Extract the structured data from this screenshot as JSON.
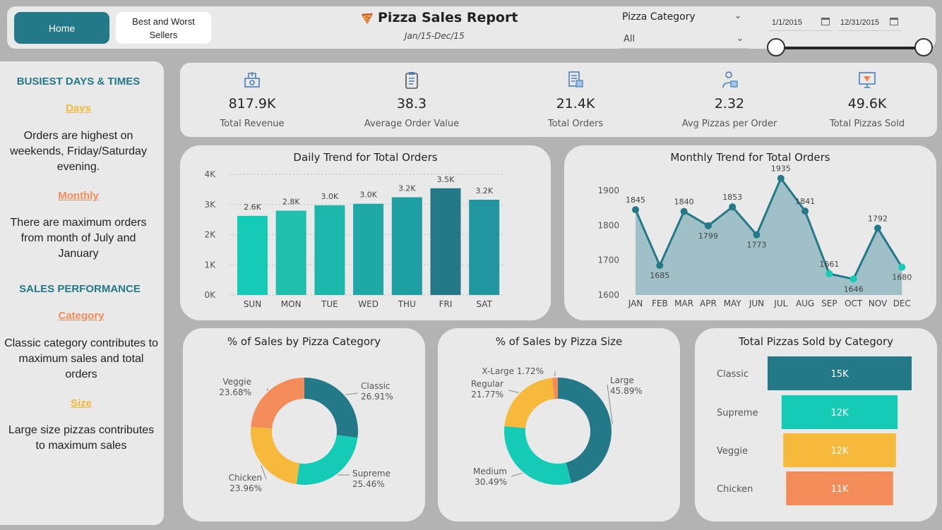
{
  "nav": {
    "home_label": "Home",
    "best_label": "Best and Worst Sellers"
  },
  "header": {
    "title": "Pizza Sales Report",
    "subtitle": "Jan/15-Dec/15",
    "icon": "pizza-icon"
  },
  "filters": {
    "category_label": "Pizza Category",
    "category_value": "All",
    "date_start": "1/1/2015",
    "date_end": "12/31/2015"
  },
  "insights": {
    "busiest_heading": "BUSIEST DAYS & TIMES",
    "days_label": "Days",
    "days_text": "Orders are highest on weekends, Friday/Saturday evening.",
    "monthly_label": "Monthly",
    "monthly_text": "There are maximum orders from month of July and January",
    "sales_heading": "SALES PERFORMANCE",
    "category_label": "Category",
    "category_text": "Classic category contributes to maximum sales and total orders",
    "size_label": "Size",
    "size_text": "Large size pizzas contributes to maximum sales"
  },
  "kpis": [
    {
      "value": "817.9K",
      "label": "Total Revenue",
      "icon": "money-icon"
    },
    {
      "value": "38.3",
      "label": "Average Order Value",
      "icon": "clipboard-icon"
    },
    {
      "value": "21.4K",
      "label": "Total Orders",
      "icon": "order-list-icon"
    },
    {
      "value": "2.32",
      "label": "Avg Pizzas per Order",
      "icon": "delivery-person-icon"
    },
    {
      "value": "49.6K",
      "label": "Total Pizzas Sold",
      "icon": "monitor-pizza-icon"
    }
  ],
  "colors": {
    "primary": "#247989",
    "accent_orange": "#f48c5a",
    "accent_yellow": "#f6b93b",
    "teal": "#14cbb6",
    "background": "#b3b3b3",
    "card": "#e9e9e9"
  },
  "chart_data": [
    {
      "id": "daily",
      "type": "bar",
      "title": "Daily Trend for Total Orders",
      "categories": [
        "SUN",
        "MON",
        "TUE",
        "WED",
        "THU",
        "FRI",
        "SAT"
      ],
      "values": [
        2624,
        2794,
        2973,
        3024,
        3239,
        3538,
        3158
      ],
      "data_labels": [
        "2.6K",
        "2.8K",
        "3.0K",
        "3.0K",
        "3.2K",
        "3.5K",
        "3.2K"
      ],
      "yticks": [
        "0K",
        "1K",
        "2K",
        "3K",
        "4K"
      ],
      "ylim": [
        0,
        4000
      ],
      "grid": true
    },
    {
      "id": "monthly",
      "type": "area",
      "title": "Monthly Trend for Total Orders",
      "categories": [
        "JAN",
        "FEB",
        "MAR",
        "APR",
        "MAY",
        "JUN",
        "JUL",
        "AUG",
        "SEP",
        "OCT",
        "NOV",
        "DEC"
      ],
      "values": [
        1845,
        1685,
        1840,
        1799,
        1853,
        1773,
        1935,
        1841,
        1661,
        1646,
        1792,
        1680
      ],
      "yticks": [
        "1600",
        "1700",
        "1800",
        "1900"
      ],
      "ylim": [
        1600,
        1900
      ],
      "grid": false
    },
    {
      "id": "category",
      "type": "pie",
      "title": "% of Sales by Pizza Category",
      "slices": [
        {
          "name": "Classic",
          "value": 26.91,
          "label": "26.91%",
          "color": "#247989"
        },
        {
          "name": "Supreme",
          "value": 25.46,
          "label": "25.46%",
          "color": "#14cbb6"
        },
        {
          "name": "Chicken",
          "value": 23.96,
          "label": "23.96%",
          "color": "#f6b93b"
        },
        {
          "name": "Veggie",
          "value": 23.68,
          "label": "23.68%",
          "color": "#f48c5a"
        }
      ]
    },
    {
      "id": "size",
      "type": "pie",
      "title": "% of Sales by Pizza Size",
      "slices": [
        {
          "name": "Large",
          "value": 45.89,
          "label": "45.89%",
          "color": "#247989"
        },
        {
          "name": "Medium",
          "value": 30.49,
          "label": "30.49%",
          "color": "#14cbb6"
        },
        {
          "name": "Regular",
          "value": 21.77,
          "label": "21.77%",
          "color": "#f6b93b"
        },
        {
          "name": "X-Large",
          "value": 1.72,
          "label": "1.72%",
          "color": "#f48c5a"
        }
      ]
    },
    {
      "id": "funnel",
      "type": "bar",
      "title": "Total Pizzas Sold by Category",
      "categories": [
        "Classic",
        "Supreme",
        "Veggie",
        "Chicken"
      ],
      "values": [
        14888,
        11987,
        11649,
        11050
      ],
      "data_labels": [
        "15K",
        "12K",
        "12K",
        "11K"
      ],
      "colors": [
        "#247989",
        "#14cbb6",
        "#f6b93b",
        "#f48c5a"
      ]
    }
  ]
}
